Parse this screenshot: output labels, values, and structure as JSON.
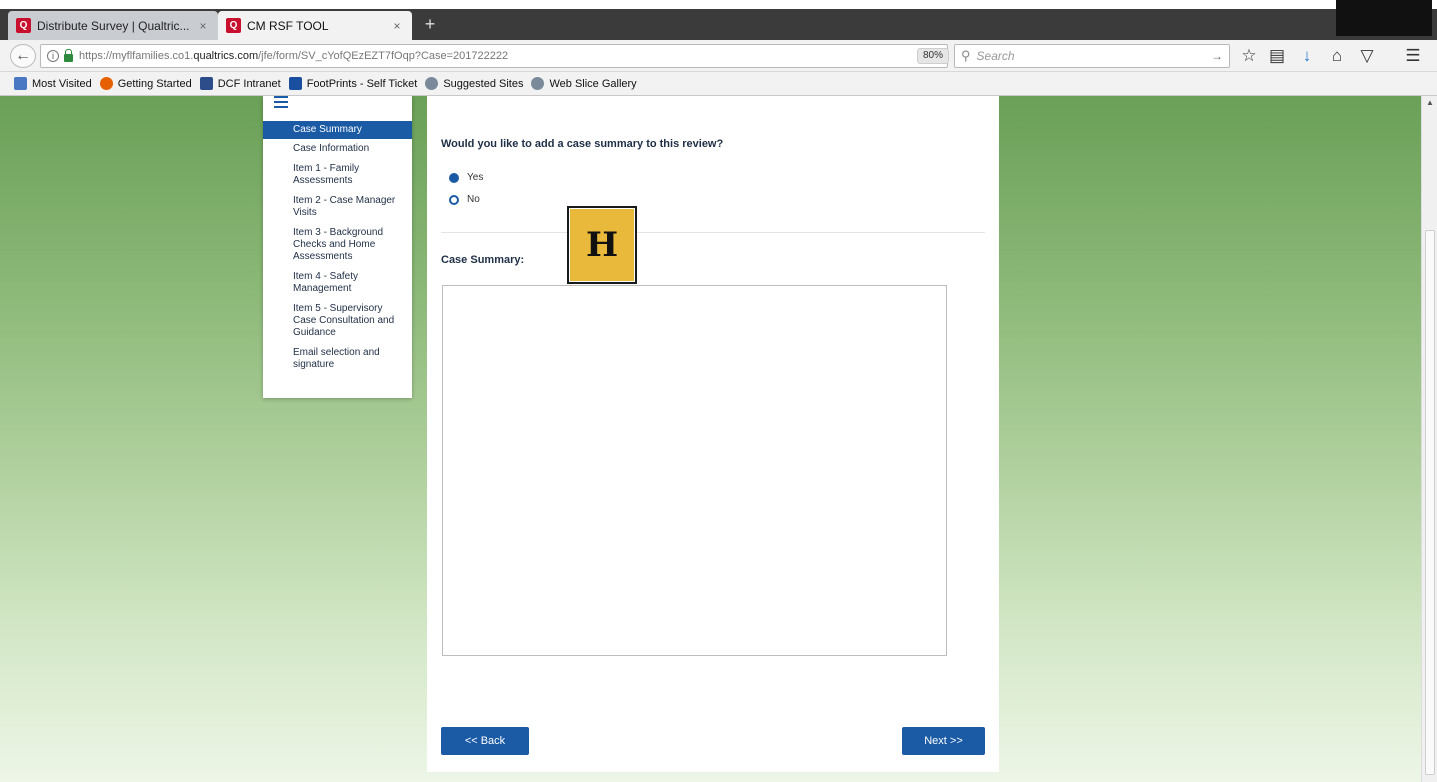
{
  "browser": {
    "tabs": [
      {
        "title": "Distribute Survey | Qualtric...",
        "close": "×",
        "active": false
      },
      {
        "title": "CM RSF TOOL",
        "close": "×",
        "active": true
      }
    ],
    "new_tab": "+",
    "url_prefix": "https://myflfamilies.co1.",
    "url_domain": "qualtrics.com",
    "url_suffix": "/jfe/form/SV_cYofQEzEZT7fOqp?Case=201722222",
    "zoom": "80%",
    "search_placeholder": "Search",
    "icons": [
      "back-icon",
      "info-icon",
      "lock-icon",
      "reload-icon",
      "search-icon",
      "star-icon",
      "clipboard-icon",
      "download-icon",
      "home-icon",
      "pocket-icon",
      "menu-icon"
    ]
  },
  "bookmarks": [
    {
      "label": "Most Visited",
      "color": "#4a78c2"
    },
    {
      "label": "Getting Started",
      "color": "#e66000"
    },
    {
      "label": "DCF Intranet",
      "color": "#2c4c8a"
    },
    {
      "label": "FootPrints - Self Ticket",
      "color": "#1a4fa0"
    },
    {
      "label": "Suggested Sites",
      "color": "#7a8a9a"
    },
    {
      "label": "Web Slice Gallery",
      "color": "#7a8a9a"
    }
  ],
  "sidenav": {
    "items": [
      "Case Summary",
      "Case Information",
      "Item 1 - Family Assessments",
      "Item 2 - Case Manager Visits",
      "Item 3 - Background Checks and Home Assessments",
      "Item 4 - Safety Management",
      "Item 5 - Supervisory Case Consultation and Guidance",
      "Email selection and signature"
    ],
    "active_index": 0
  },
  "form": {
    "question": "Would you like to add a case summary to this review?",
    "options": [
      {
        "label": "Yes",
        "checked": true
      },
      {
        "label": "No",
        "checked": false
      }
    ],
    "summary_label": "Case Summary:",
    "summary_value": "",
    "back_label": "<< Back",
    "next_label": "Next >>"
  },
  "marker_label": "H",
  "colors": {
    "accent": "#1b5aa5",
    "marker": "#e8b93a",
    "background_top": "#6aa057",
    "background_bottom": "#edf6e7"
  }
}
